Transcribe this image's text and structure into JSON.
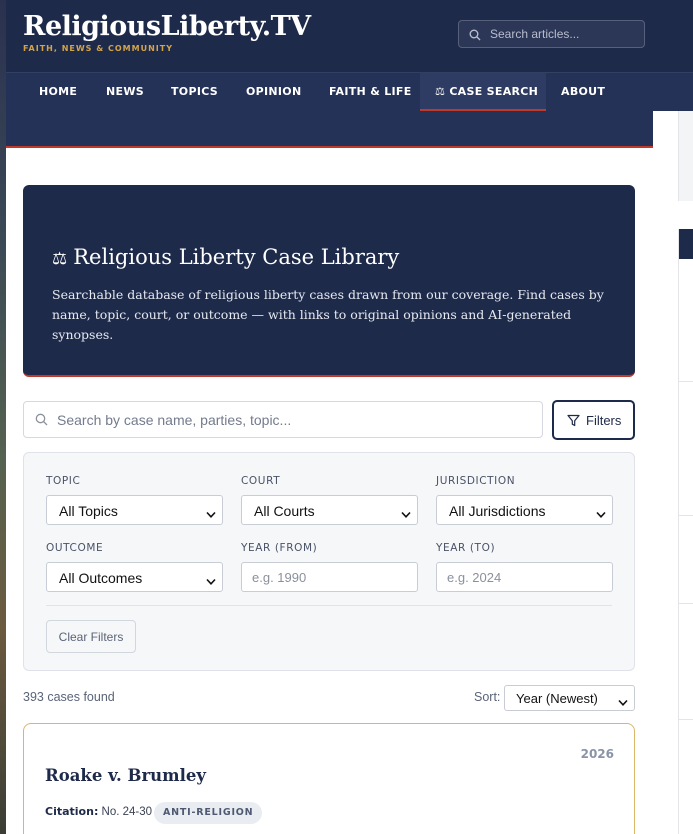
{
  "site": {
    "logo": "ReligiousLiberty.TV",
    "tagline": "FAITH, NEWS & COMMUNITY",
    "search_placeholder": "Search articles..."
  },
  "nav": {
    "items": [
      {
        "label": "HOME"
      },
      {
        "label": "NEWS"
      },
      {
        "label": "TOPICS"
      },
      {
        "label": "OPINION"
      },
      {
        "label": "FAITH & LIFE"
      },
      {
        "label": "CASE SEARCH",
        "icon": "scales-icon",
        "active": true
      },
      {
        "label": "ABOUT"
      }
    ]
  },
  "hero": {
    "icon": "scales-icon",
    "title": "Religious Liberty Case Library",
    "description": "Searchable database of religious liberty cases drawn from our coverage. Find cases by name, topic, court, or outcome — with links to original opinions and AI-generated synopses."
  },
  "search": {
    "placeholder": "Search by case name, parties, topic...",
    "filters_label": "Filters"
  },
  "filters": {
    "topic": {
      "label": "TOPIC",
      "value": "All Topics"
    },
    "court": {
      "label": "COURT",
      "value": "All Courts"
    },
    "jurisdiction": {
      "label": "JURISDICTION",
      "value": "All Jurisdictions"
    },
    "outcome": {
      "label": "OUTCOME",
      "value": "All Outcomes"
    },
    "year_from": {
      "label": "YEAR (FROM)",
      "placeholder": "e.g. 1990"
    },
    "year_to": {
      "label": "YEAR (TO)",
      "placeholder": "e.g. 2024"
    },
    "clear_label": "Clear Filters"
  },
  "results": {
    "count_text": "393 cases found",
    "sort_label": "Sort:",
    "sort_value": "Year (Newest)"
  },
  "cases": [
    {
      "year": "2026",
      "title": "Roake v. Brumley",
      "citation_label": "Citation:",
      "citation": "No. 24-30",
      "tag": "ANTI-RELIGION"
    }
  ],
  "colors": {
    "navy": "#1e2a4a",
    "accent_red": "#c0392b",
    "gold": "#d4a44a"
  }
}
